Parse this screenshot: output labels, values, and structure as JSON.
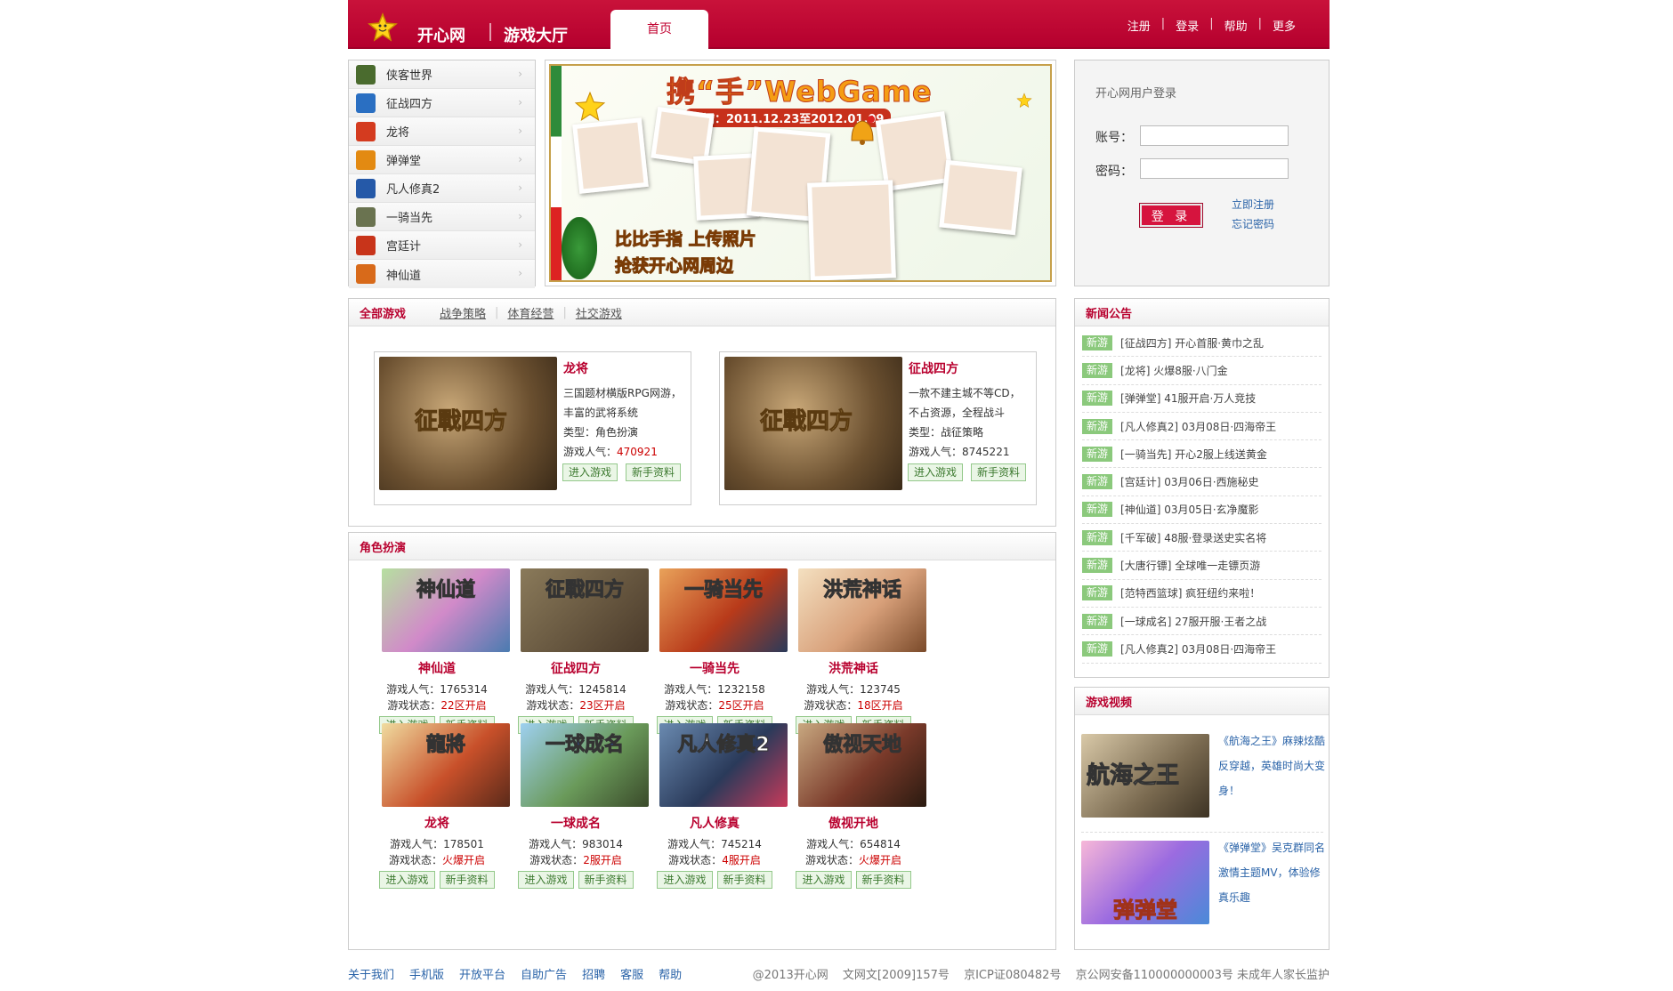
{
  "header": {
    "site_name": "开心网",
    "section_name": "游戏大厅",
    "home_tab": "首页",
    "nav": [
      "注册",
      "登录",
      "帮助",
      "更多"
    ]
  },
  "game_list": [
    {
      "name": "侠客世界",
      "color": "#4a6b2e"
    },
    {
      "name": "征战四方",
      "color": "#2a6fc2"
    },
    {
      "name": "龙将",
      "color": "#d43b1f"
    },
    {
      "name": "弹弹堂",
      "color": "#e38a12"
    },
    {
      "name": "凡人修真2",
      "color": "#2559a8"
    },
    {
      "name": "一骑当先",
      "color": "#6a7350"
    },
    {
      "name": "宫廷计",
      "color": "#c8341a"
    },
    {
      "name": "神仙道",
      "color": "#d86a1a"
    }
  ],
  "banner": {
    "title": "携“手”WebGame",
    "date": "时间：2011.12.23至2012.01.09",
    "line1": "比比手指 上传照片",
    "line2": "抢获开心网周边"
  },
  "login": {
    "title": "开心网用户登录",
    "account_label": "账号：",
    "password_label": "密码：",
    "button": "登 录",
    "register_link": "立即注册",
    "forgot_link": "忘记密码"
  },
  "all_games": {
    "tabs": [
      "全部游戏",
      "战争策略",
      "体育经营",
      "社交游戏"
    ],
    "featured": [
      {
        "name": "龙将",
        "desc1": "三国题材横版RPG网游，",
        "desc2": "丰富的武将系统",
        "type": "类型：角色扮演",
        "pop_label": "游戏人气：",
        "pop": "470921",
        "enter": "进入游戏",
        "guide": "新手资料"
      },
      {
        "name": "征战四方",
        "desc1": "一款不建主城不等CD，",
        "desc2": "不占资源，全程战斗",
        "type": "类型：战征策略",
        "pop_label": "游戏人气：",
        "pop": "8745221",
        "enter": "进入游戏",
        "guide": "新手资料"
      }
    ]
  },
  "role_play": {
    "title": "角色扮演",
    "games": [
      {
        "name": "神仙道",
        "pop": "游戏人气：1765314",
        "status_label": "游戏状态：",
        "status": "22区开启",
        "enter": "进入游戏",
        "guide": "新手资料"
      },
      {
        "name": "征战四方",
        "pop": "游戏人气：1245814",
        "status_label": "游戏状态：",
        "status": "23区开启",
        "enter": "进入游戏",
        "guide": "新手资料"
      },
      {
        "name": "一骑当先",
        "pop": "游戏人气：1232158",
        "status_label": "游戏状态：",
        "status": "25区开启",
        "enter": "进入游戏",
        "guide": "新手资料"
      },
      {
        "name": "洪荒神话",
        "pop": "游戏人气：123745",
        "status_label": "游戏状态：",
        "status": "18区开启",
        "enter": "进入游戏",
        "guide": "新手资料"
      },
      {
        "name": "龙将",
        "pop": "游戏人气：178501",
        "status_label": "游戏状态：",
        "status": "火爆开启",
        "enter": "进入游戏",
        "guide": "新手资料"
      },
      {
        "name": "一球成名",
        "pop": "游戏人气：983014",
        "status_label": "游戏状态：",
        "status": "2服开启",
        "enter": "进入游戏",
        "guide": "新手资料"
      },
      {
        "name": "凡人修真",
        "pop": "游戏人气：745214",
        "status_label": "游戏状态：",
        "status": "4服开启",
        "enter": "进入游戏",
        "guide": "新手资料"
      },
      {
        "name": "傲视开地",
        "pop": "游戏人气：654814",
        "status_label": "游戏状态：",
        "status": "火爆开启",
        "enter": "进入游戏",
        "guide": "新手资料"
      }
    ],
    "image_titles": [
      "神仙道",
      "征戰四方",
      "一骑当先",
      "洪荒神话",
      "龍將",
      "一球成名",
      "凡人修真2",
      "傲视天地"
    ]
  },
  "news": {
    "title": "新闻公告",
    "badge": "新游",
    "items": [
      "[征战四方] 开心首服·黄巾之乱",
      "[龙将] 火爆8服·八门金",
      "[弹弹堂] 41服开启·万人竞技",
      "[凡人修真2] 03月08日·四海帝王",
      "[一骑当先] 开心2服上线送黄金",
      "[宫廷计] 03月06日·西施秘史",
      "[神仙道] 03月05日·玄净魔影",
      "[千军破] 48服·登录送史实名将",
      "[大唐行镖] 全球唯一走镖页游",
      "[范特西篮球] 疯狂纽约来啦！",
      "[一球成名] 27服开服·王者之战",
      "[凡人修真2] 03月08日·四海帝王"
    ]
  },
  "video": {
    "title": "游戏视频",
    "items": [
      {
        "img_title": "航海之王",
        "text": "《航海之王》麻辣炫酷反穿越，英雄时尚大变身！"
      },
      {
        "img_title": "弹弹堂",
        "text": "《弹弹堂》吴克群同名激情主题MV，体验修真乐趣"
      }
    ]
  },
  "footer": {
    "links": [
      "关于我们",
      "手机版",
      "开放平台",
      "自助广告",
      "招聘",
      "客服",
      "帮助"
    ],
    "copyright": "@2013开心网",
    "license1": "文网文[2009]157号",
    "license2": "京ICP证080482号",
    "license3": "京公网安备110000000003号 未成年人家长监护"
  },
  "colors": {
    "brand_red": "#c9123a",
    "link_blue": "#2a63a8",
    "badge_green": "#8bc97c"
  }
}
